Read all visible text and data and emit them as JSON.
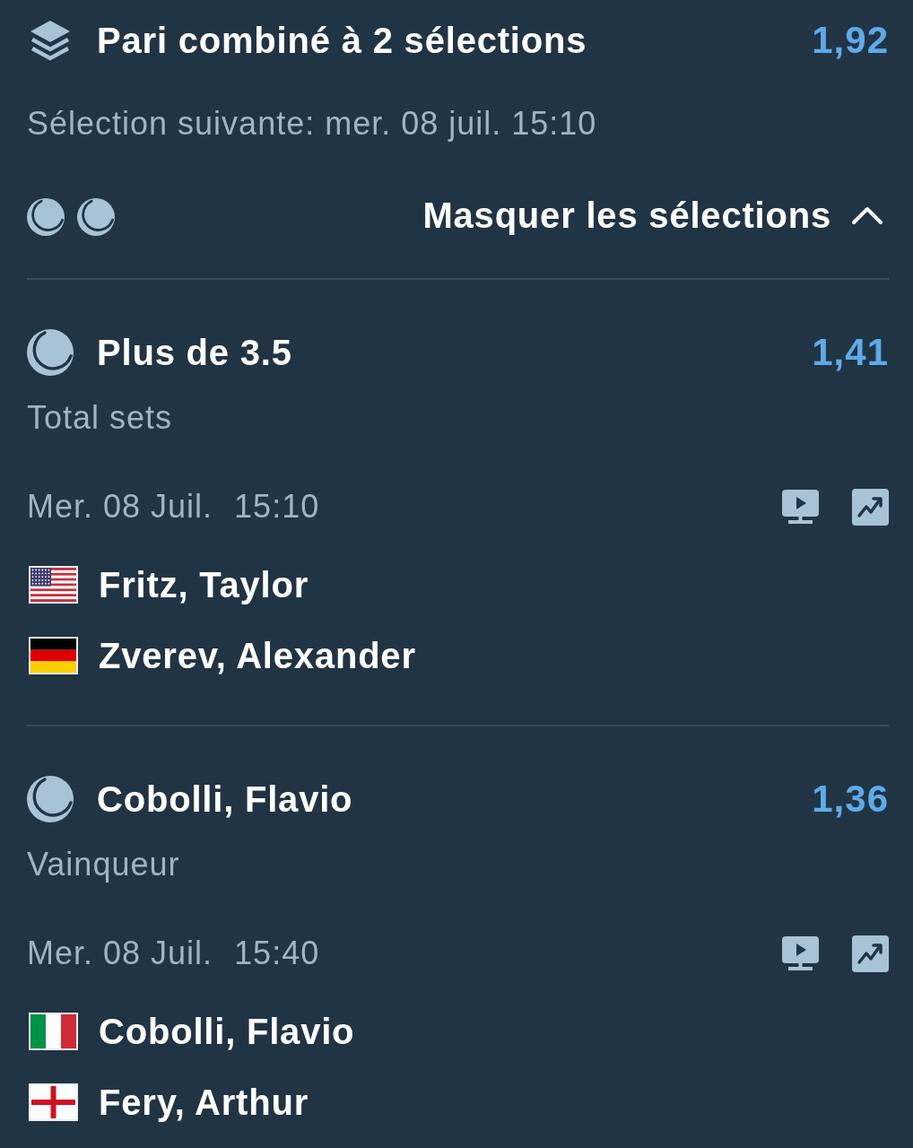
{
  "bet": {
    "title": "Pari combiné à 2 sélections",
    "odds": "1,92",
    "next_selection": "Sélection suivante: mer. 08 juil. 15:10"
  },
  "toggle": {
    "label": "Masquer les sélections",
    "expanded": true
  },
  "selections": [
    {
      "pick": "Plus de 3.5",
      "odds": "1,41",
      "market": "Total sets",
      "date": "Mer. 08 Juil.",
      "time": "15:10",
      "players": [
        {
          "name": "Fritz, Taylor",
          "kind": "usa"
        },
        {
          "name": "Zverev, Alexander",
          "kind": "germany"
        }
      ]
    },
    {
      "pick": "Cobolli, Flavio",
      "odds": "1,36",
      "market": "Vainqueur",
      "date": "Mer. 08 Juil.",
      "time": "15:40",
      "players": [
        {
          "name": "Cobolli, Flavio",
          "kind": "italy"
        },
        {
          "name": "Fery, Arthur",
          "kind": "england"
        }
      ]
    }
  ]
}
